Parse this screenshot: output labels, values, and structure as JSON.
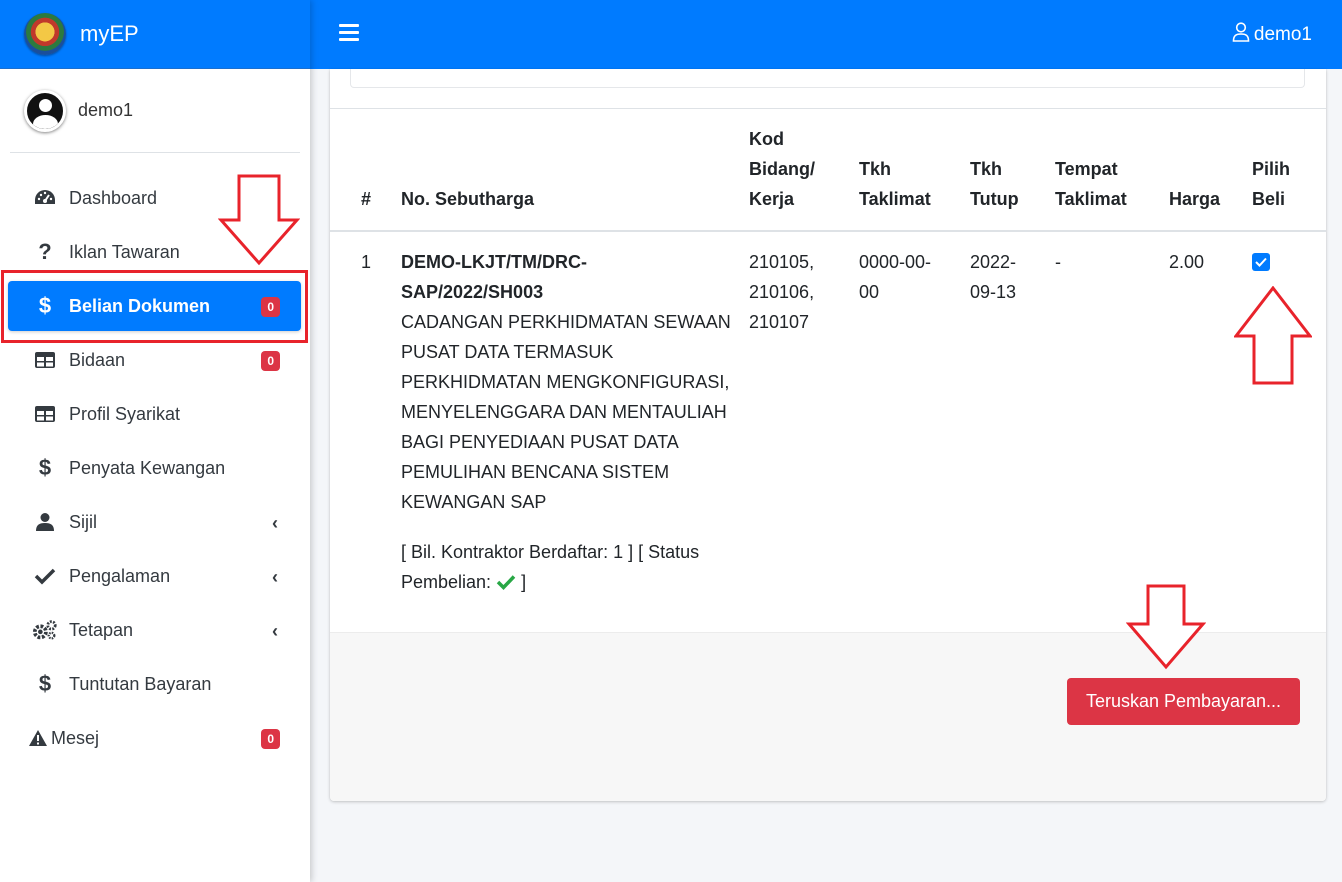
{
  "brand": {
    "name": "myEP"
  },
  "sidebar": {
    "user": "demo1",
    "items": [
      {
        "label": "Dashboard",
        "icon": "tachometer-icon"
      },
      {
        "label": "Iklan Tawaran",
        "icon": "question-icon"
      },
      {
        "label": "Belian Dokumen",
        "icon": "dollar-icon",
        "badge": "0",
        "active": true
      },
      {
        "label": "Bidaan",
        "icon": "table-icon",
        "badge": "0"
      },
      {
        "label": "Profil Syarikat",
        "icon": "table-icon"
      },
      {
        "label": "Penyata Kewangan",
        "icon": "dollar-icon"
      },
      {
        "label": "Sijil",
        "icon": "user-icon",
        "chevron": true
      },
      {
        "label": "Pengalaman",
        "icon": "check-icon",
        "chevron": true
      },
      {
        "label": "Tetapan",
        "icon": "cogs-icon",
        "chevron": true
      },
      {
        "label": "Tuntutan Bayaran",
        "icon": "dollar-icon"
      },
      {
        "label": "Mesej",
        "icon": "warning-icon",
        "badge": "0"
      }
    ],
    "icons": {
      "dollar": "$",
      "question": "?",
      "chevron": "‹"
    }
  },
  "topbar": {
    "user": "demo1"
  },
  "table": {
    "headers": {
      "num": "#",
      "no": "No. Sebutharga",
      "kod_1": "Kod",
      "kod_2": "Bidang/",
      "kod_3": "Kerja",
      "tkh_taklimat_1": "Tkh",
      "tkh_taklimat_2": "Taklimat",
      "tkh_tutup_1": "Tkh",
      "tkh_tutup_2": "Tutup",
      "tempat_1": "Tempat",
      "tempat_2": "Taklimat",
      "harga": "Harga",
      "pilih_1": "Pilih",
      "pilih_2": "Beli"
    },
    "rows": [
      {
        "num": "1",
        "code_1": "DEMO-LKJT/TM/DRC-",
        "code_2": "SAP/2022/SH003",
        "desc_lines": [
          "CADANGAN PERKHIDMATAN SEWAAN",
          "PUSAT DATA TERMASUK",
          "PERKHIDMATAN MENGKONFIGURASI,",
          "MENYELENGGARA DAN MENTAULIAH",
          "BAGI PENYEDIAAN PUSAT DATA",
          "PEMULIHAN BENCANA SISTEM",
          "KEWANGAN SAP"
        ],
        "info_1": "[ Bil. Kontraktor Berdaftar: 1 ] [ Status",
        "info_2": "Pembelian:",
        "info_close": "]",
        "kod_lines": [
          "210105,",
          "210106,",
          "210107"
        ],
        "tkh_taklimat_1": "0000-00-",
        "tkh_taklimat_2": "00",
        "tkh_tutup_1": "2022-",
        "tkh_tutup_2": "09-13",
        "tempat": "-",
        "harga": "2.00",
        "checked": true
      }
    ]
  },
  "footer": {
    "pay_button": "Teruskan Pembayaran..."
  },
  "colors": {
    "primary": "#007bff",
    "danger": "#dc3545",
    "success": "#28a745",
    "annotation": "#e8232b"
  }
}
